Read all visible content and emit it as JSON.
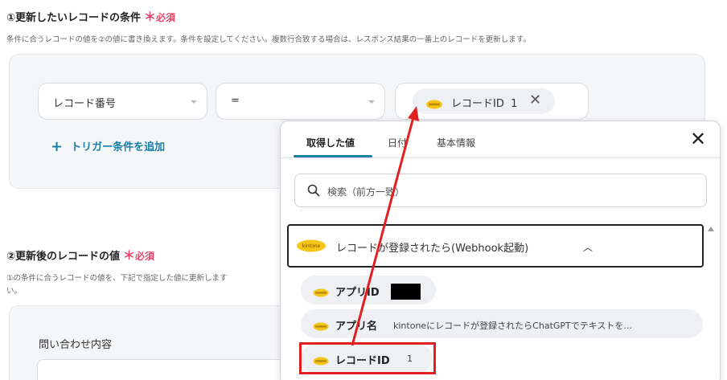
{
  "section1": {
    "title": "①更新したいレコードの条件",
    "required_star": "＊",
    "required_label": "必須",
    "description": "条件に合うレコードの値を②の値に書き換えます。条件を設定してください。複数行合致する場合は、レスポンス結果の一番上のレコードを更新します。",
    "field_select": "レコード番号",
    "operator_select": "=",
    "value_chip": {
      "label": "レコードID",
      "value": "1",
      "icon": "kintone-icon"
    },
    "add_trigger_label": "トリガー条件を追加",
    "add_trigger_icon": "plus-icon"
  },
  "section2": {
    "title": "②更新後のレコードの値",
    "required_star": "＊",
    "required_label": "必須",
    "description": "①の条件に合うレコードの値を、下記で指定した値に更新します",
    "description_cont": "い。",
    "field_label": "問い合わせ内容"
  },
  "popup": {
    "tabs": [
      {
        "label": "取得した値",
        "active": true
      },
      {
        "label": "日付",
        "active": false
      },
      {
        "label": "基本情報",
        "active": false
      }
    ],
    "close_icon": "close-icon",
    "search_placeholder": "検索（前方一致）",
    "group": {
      "label": "レコードが登録されたら(Webhook起動)",
      "icon": "kintone-icon",
      "chevron": "chevron-up-icon"
    },
    "items": [
      {
        "name": "アプリID",
        "value": ""
      },
      {
        "name": "アプリ名",
        "value": "kintoneにレコードが登録されたらChatGPTでテキストを..."
      },
      {
        "name": "レコードID",
        "value": "1"
      }
    ]
  },
  "colors": {
    "accent": "#1a7fa6",
    "required": "#e5446b",
    "annotation": "#e02020",
    "kintone": "#f5c518"
  }
}
